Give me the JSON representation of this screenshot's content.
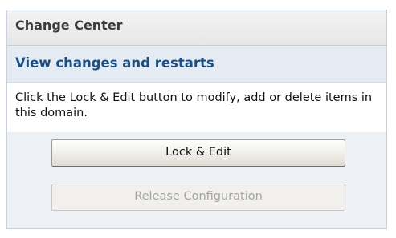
{
  "panel": {
    "title": "Change Center",
    "section_title": "View changes and restarts",
    "description": "Click the Lock & Edit button to modify, add or delete items in this domain."
  },
  "buttons": {
    "lock_edit_label": "Lock & Edit",
    "release_configuration_label": "Release Configuration",
    "release_configuration_state": "disabled"
  },
  "colors": {
    "section_title": "#1c4f86",
    "panel_background": "#edf1f6",
    "disabled_text": "#a4a4a4"
  }
}
